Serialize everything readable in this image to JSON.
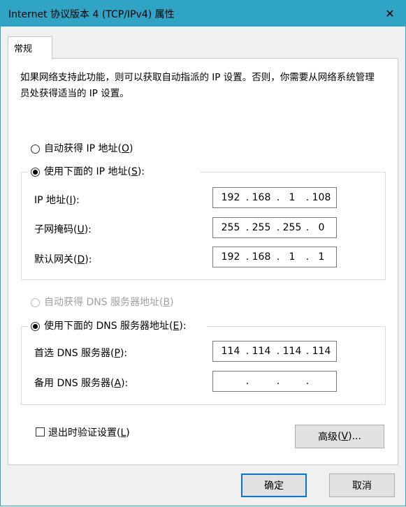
{
  "window": {
    "title": "Internet 协议版本 4 (TCP/IPv4) 属性",
    "close_glyph": "✕"
  },
  "tabs": [
    {
      "label": "常规",
      "active": true
    }
  ],
  "description": "如果网络支持此功能，则可以获取自动指派的 IP 设置。否则，你需要从网络系统管理员处获得适当的 IP 设置。",
  "ip_section": {
    "auto_option": {
      "label": "自动获得 IP 地址",
      "accel": "O",
      "selected": false
    },
    "manual_option": {
      "label": "使用下面的 IP 地址",
      "accel": "S",
      "selected": true
    },
    "fields": [
      {
        "label": "IP 地址",
        "accel": "I",
        "octets": [
          "192",
          "168",
          "1",
          "108"
        ]
      },
      {
        "label": "子网掩码",
        "accel": "U",
        "octets": [
          "255",
          "255",
          "255",
          "0"
        ]
      },
      {
        "label": "默认网关",
        "accel": "D",
        "octets": [
          "192",
          "168",
          "1",
          "1"
        ]
      }
    ]
  },
  "dns_section": {
    "auto_option": {
      "label": "自动获得 DNS 服务器地址",
      "accel": "B",
      "selected": false,
      "disabled": true
    },
    "manual_option": {
      "label": "使用下面的 DNS 服务器地址",
      "accel": "E",
      "selected": true
    },
    "fields": [
      {
        "label": "首选 DNS 服务器",
        "accel": "P",
        "octets": [
          "114",
          "114",
          "114",
          "114"
        ]
      },
      {
        "label": "备用 DNS 服务器",
        "accel": "A",
        "octets": [
          "",
          "",
          "",
          ""
        ]
      }
    ]
  },
  "validate_checkbox": {
    "label": "退出时验证设置",
    "accel": "L",
    "checked": false
  },
  "advanced_button": {
    "label": "高级",
    "accel": "V",
    "suffix": "..."
  },
  "ok_button": {
    "label": "确定"
  },
  "cancel_button": {
    "label": "取消"
  }
}
